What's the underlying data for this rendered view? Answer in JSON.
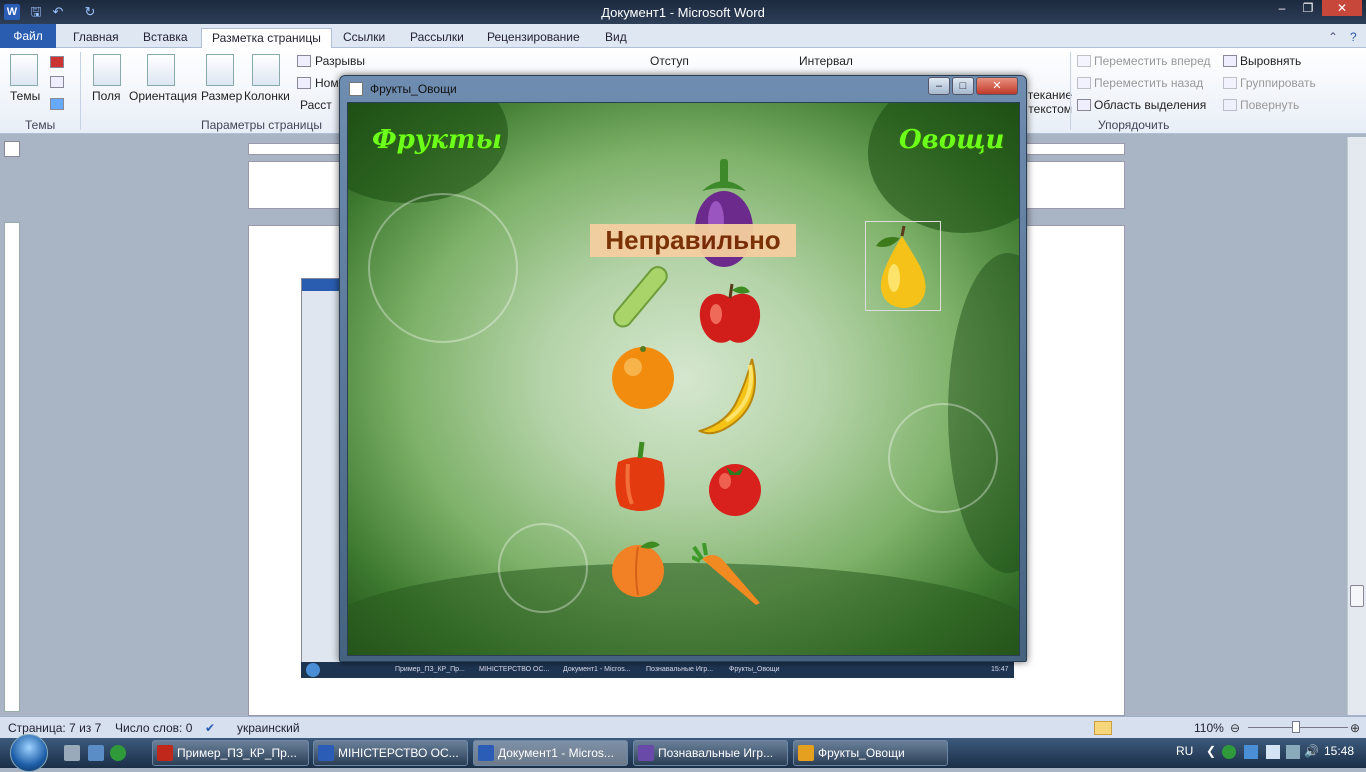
{
  "word": {
    "window_title": "Документ1 - Microsoft Word",
    "tabs": [
      "Файл",
      "Главная",
      "Вставка",
      "Разметка страницы",
      "Ссылки",
      "Рассылки",
      "Рецензирование",
      "Вид"
    ],
    "active_tab": "Разметка страницы",
    "ribbon": {
      "themes_label": "Темы",
      "group_themes": "Темы",
      "margins": "Поля",
      "orientation": "Ориентация",
      "size": "Размер",
      "columns": "Колонки",
      "breaks": "Разрывы",
      "line_numbers": "Ном",
      "hyphenation": "Расст",
      "group_page_setup": "Параметры страницы",
      "indent": "Отступ",
      "spacing": "Интервал",
      "wrap_text": "текание текстом",
      "bring_forward": "Переместить вперед",
      "send_backward": "Переместить назад",
      "selection_pane": "Область выделения",
      "align": "Выровнять",
      "group": "Группировать",
      "rotate": "Повернуть",
      "group_arrange": "Упорядочить"
    },
    "status": {
      "page": "Страница: 7 из 7",
      "words": "Число слов: 0",
      "language": "украинский",
      "zoom": "110%"
    }
  },
  "app_window": {
    "title": "Фрукты_Овощи",
    "header_left": "Фрукты",
    "header_right": "Овощи",
    "message": "Неправильно",
    "items": [
      "eggplant",
      "cucumber",
      "apple",
      "orange",
      "banana",
      "pepper",
      "tomato",
      "peach",
      "carrot",
      "pear"
    ]
  },
  "taskbar": {
    "buttons": [
      "Пример_ПЗ_КР_Пр...",
      "МІНІСТЕРСТВО ОС...",
      "Документ1 - Micros...",
      "Познавальные Игр...",
      "Фрукты_Овощи"
    ],
    "lang": "RU",
    "time": "15:48"
  },
  "embedded_taskbar": [
    "Пример_ПЗ_КР_Пр...",
    "МІНІСТЕРСТВО ОС...",
    "Документ1 - Micros...",
    "Познавальные Игр...",
    "Фрукты_Овощи"
  ],
  "embedded_time": "15:47"
}
